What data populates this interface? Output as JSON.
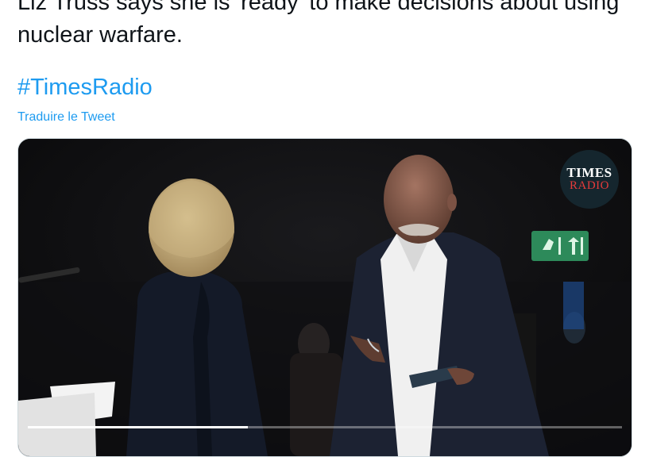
{
  "tweet": {
    "text": "Liz Truss says she is 'ready' to make decisions about using nuclear warfare.",
    "hashtag": "#TimesRadio",
    "translate_label": "Traduire le Tweet"
  },
  "video": {
    "logo_line1": "TIMES",
    "logo_line2": "RADIO",
    "progress": 0.37
  },
  "colors": {
    "link": "#1d9bf0",
    "text": "#0f1419",
    "logo_red": "#e63b3b"
  }
}
